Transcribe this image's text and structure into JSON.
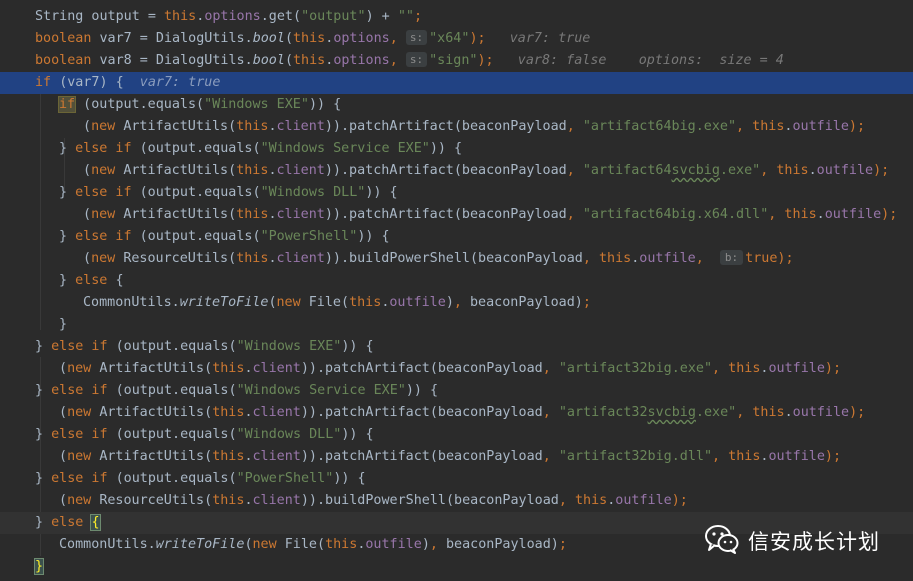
{
  "lines": [
    {
      "id": "l1",
      "parts": [
        {
          "t": "String output = ",
          "c": ""
        },
        {
          "t": "this",
          "c": "kw"
        },
        {
          "t": ".",
          "c": ""
        },
        {
          "t": "options",
          "c": "fld"
        },
        {
          "t": ".get(",
          "c": ""
        },
        {
          "t": "\"output\"",
          "c": "str"
        },
        {
          "t": ") + ",
          "c": ""
        },
        {
          "t": "\"\"",
          "c": "str"
        },
        {
          "t": ";",
          "c": "kw"
        }
      ]
    },
    {
      "id": "l2",
      "parts": [
        {
          "t": "boolean ",
          "c": "kw"
        },
        {
          "t": "var7 = DialogUtils.",
          "c": ""
        },
        {
          "t": "bool",
          "c": "it"
        },
        {
          "t": "(",
          "c": ""
        },
        {
          "t": "this",
          "c": "kw"
        },
        {
          "t": ".",
          "c": ""
        },
        {
          "t": "options",
          "c": "fld"
        },
        {
          "t": ",",
          "c": "kw"
        },
        {
          "t": " ",
          "c": ""
        },
        {
          "t": "s:",
          "c": "hint"
        },
        {
          "t": "\"x64\"",
          "c": "str"
        },
        {
          "t": ");",
          "c": "kw"
        },
        {
          "t": "   var7: true",
          "c": "dbg"
        }
      ]
    },
    {
      "id": "l3",
      "parts": [
        {
          "t": "boolean ",
          "c": "kw"
        },
        {
          "t": "var8 = DialogUtils.",
          "c": ""
        },
        {
          "t": "bool",
          "c": "it"
        },
        {
          "t": "(",
          "c": ""
        },
        {
          "t": "this",
          "c": "kw"
        },
        {
          "t": ".",
          "c": ""
        },
        {
          "t": "options",
          "c": "fld"
        },
        {
          "t": ",",
          "c": "kw"
        },
        {
          "t": " ",
          "c": ""
        },
        {
          "t": "s:",
          "c": "hint"
        },
        {
          "t": "\"sign\"",
          "c": "str"
        },
        {
          "t": ");",
          "c": "kw"
        },
        {
          "t": "   var8: false    options:  size = 4",
          "c": "dbg"
        }
      ]
    },
    {
      "id": "l4",
      "parts": [
        {
          "t": "if ",
          "c": "kw"
        },
        {
          "t": "(var7) {",
          "c": ""
        },
        {
          "t": "  var7: true",
          "c": "dbg-hl"
        }
      ]
    },
    {
      "id": "l5",
      "parts": [
        {
          "t": "if",
          "c": "kw boxkw"
        },
        {
          "t": " (output.equals(",
          "c": ""
        },
        {
          "t": "\"Windows EXE\"",
          "c": "str"
        },
        {
          "t": ")) {",
          "c": ""
        }
      ]
    },
    {
      "id": "l6",
      "parts": [
        {
          "t": "(",
          "c": ""
        },
        {
          "t": "new ",
          "c": "kw"
        },
        {
          "t": "ArtifactUtils(",
          "c": ""
        },
        {
          "t": "this",
          "c": "kw"
        },
        {
          "t": ".",
          "c": ""
        },
        {
          "t": "client",
          "c": "fld"
        },
        {
          "t": ")).patchArtifact(beaconPayload",
          "c": ""
        },
        {
          "t": ", ",
          "c": "kw"
        },
        {
          "t": "\"artifact64big.exe\"",
          "c": "str"
        },
        {
          "t": ", ",
          "c": "kw"
        },
        {
          "t": "this",
          "c": "kw"
        },
        {
          "t": ".",
          "c": ""
        },
        {
          "t": "outfile",
          "c": "fld"
        },
        {
          "t": ");",
          "c": "kw"
        }
      ]
    },
    {
      "id": "l7",
      "parts": [
        {
          "t": "} ",
          "c": ""
        },
        {
          "t": "else if ",
          "c": "kw"
        },
        {
          "t": "(output.equals(",
          "c": ""
        },
        {
          "t": "\"Windows Service EXE\"",
          "c": "str"
        },
        {
          "t": ")) {",
          "c": ""
        }
      ]
    },
    {
      "id": "l8",
      "parts": [
        {
          "t": "(",
          "c": ""
        },
        {
          "t": "new ",
          "c": "kw"
        },
        {
          "t": "ArtifactUtils(",
          "c": ""
        },
        {
          "t": "this",
          "c": "kw"
        },
        {
          "t": ".",
          "c": ""
        },
        {
          "t": "client",
          "c": "fld"
        },
        {
          "t": ")).patchArtifact(beaconPayload",
          "c": ""
        },
        {
          "t": ", ",
          "c": "kw"
        },
        {
          "t": "\"artifact64",
          "c": "str"
        },
        {
          "t": "svcbig",
          "c": "str wavy"
        },
        {
          "t": ".exe\"",
          "c": "str"
        },
        {
          "t": ", ",
          "c": "kw"
        },
        {
          "t": "this",
          "c": "kw"
        },
        {
          "t": ".",
          "c": ""
        },
        {
          "t": "outfile",
          "c": "fld"
        },
        {
          "t": ");",
          "c": "kw"
        }
      ]
    },
    {
      "id": "l9",
      "parts": [
        {
          "t": "} ",
          "c": ""
        },
        {
          "t": "else if ",
          "c": "kw"
        },
        {
          "t": "(output.equals(",
          "c": ""
        },
        {
          "t": "\"Windows DLL\"",
          "c": "str"
        },
        {
          "t": ")) {",
          "c": ""
        }
      ]
    },
    {
      "id": "l10",
      "parts": [
        {
          "t": "(",
          "c": ""
        },
        {
          "t": "new ",
          "c": "kw"
        },
        {
          "t": "ArtifactUtils(",
          "c": ""
        },
        {
          "t": "this",
          "c": "kw"
        },
        {
          "t": ".",
          "c": ""
        },
        {
          "t": "client",
          "c": "fld"
        },
        {
          "t": ")).patchArtifact(beaconPayload",
          "c": ""
        },
        {
          "t": ", ",
          "c": "kw"
        },
        {
          "t": "\"artifact64big.x64.dll\"",
          "c": "str"
        },
        {
          "t": ", ",
          "c": "kw"
        },
        {
          "t": "this",
          "c": "kw"
        },
        {
          "t": ".",
          "c": ""
        },
        {
          "t": "outfile",
          "c": "fld"
        },
        {
          "t": ");",
          "c": "kw"
        }
      ]
    },
    {
      "id": "l11",
      "parts": [
        {
          "t": "} ",
          "c": ""
        },
        {
          "t": "else if ",
          "c": "kw"
        },
        {
          "t": "(output.equals(",
          "c": ""
        },
        {
          "t": "\"PowerShell\"",
          "c": "str"
        },
        {
          "t": ")) {",
          "c": ""
        }
      ]
    },
    {
      "id": "l12",
      "parts": [
        {
          "t": "(",
          "c": ""
        },
        {
          "t": "new ",
          "c": "kw"
        },
        {
          "t": "ResourceUtils(",
          "c": ""
        },
        {
          "t": "this",
          "c": "kw"
        },
        {
          "t": ".",
          "c": ""
        },
        {
          "t": "client",
          "c": "fld"
        },
        {
          "t": ")).buildPowerShell(beaconPayload",
          "c": ""
        },
        {
          "t": ", ",
          "c": "kw"
        },
        {
          "t": "this",
          "c": "kw"
        },
        {
          "t": ".",
          "c": ""
        },
        {
          "t": "outfile",
          "c": "fld"
        },
        {
          "t": ", ",
          "c": "kw"
        },
        {
          "t": " ",
          "c": ""
        },
        {
          "t": "b:",
          "c": "hint b"
        },
        {
          "t": "true",
          "c": "kw"
        },
        {
          "t": ");",
          "c": "kw"
        }
      ]
    },
    {
      "id": "l13",
      "parts": [
        {
          "t": "} ",
          "c": ""
        },
        {
          "t": "else ",
          "c": "kw"
        },
        {
          "t": "{",
          "c": ""
        }
      ]
    },
    {
      "id": "l14",
      "parts": [
        {
          "t": "CommonUtils.",
          "c": ""
        },
        {
          "t": "writeToFile",
          "c": "it"
        },
        {
          "t": "(",
          "c": ""
        },
        {
          "t": "new ",
          "c": "kw"
        },
        {
          "t": "File(",
          "c": ""
        },
        {
          "t": "this",
          "c": "kw"
        },
        {
          "t": ".",
          "c": ""
        },
        {
          "t": "outfile",
          "c": "fld"
        },
        {
          "t": ")",
          "c": ""
        },
        {
          "t": ", ",
          "c": "kw"
        },
        {
          "t": "beaconPayload)",
          "c": ""
        },
        {
          "t": ";",
          "c": "kw"
        }
      ]
    },
    {
      "id": "l15",
      "parts": [
        {
          "t": "}",
          "c": ""
        }
      ]
    },
    {
      "id": "l16",
      "parts": [
        {
          "t": "} ",
          "c": ""
        },
        {
          "t": "else if ",
          "c": "kw"
        },
        {
          "t": "(output.equals(",
          "c": ""
        },
        {
          "t": "\"Windows EXE\"",
          "c": "str"
        },
        {
          "t": ")) {",
          "c": ""
        }
      ]
    },
    {
      "id": "l17",
      "parts": [
        {
          "t": "(",
          "c": ""
        },
        {
          "t": "new ",
          "c": "kw"
        },
        {
          "t": "ArtifactUtils(",
          "c": ""
        },
        {
          "t": "this",
          "c": "kw"
        },
        {
          "t": ".",
          "c": ""
        },
        {
          "t": "client",
          "c": "fld"
        },
        {
          "t": ")).patchArtifact(beaconPayload",
          "c": ""
        },
        {
          "t": ", ",
          "c": "kw"
        },
        {
          "t": "\"artifact32big.exe\"",
          "c": "str"
        },
        {
          "t": ", ",
          "c": "kw"
        },
        {
          "t": "this",
          "c": "kw"
        },
        {
          "t": ".",
          "c": ""
        },
        {
          "t": "outfile",
          "c": "fld"
        },
        {
          "t": ");",
          "c": "kw"
        }
      ]
    },
    {
      "id": "l18",
      "parts": [
        {
          "t": "} ",
          "c": ""
        },
        {
          "t": "else if ",
          "c": "kw"
        },
        {
          "t": "(output.equals(",
          "c": ""
        },
        {
          "t": "\"Windows Service EXE\"",
          "c": "str"
        },
        {
          "t": ")) {",
          "c": ""
        }
      ]
    },
    {
      "id": "l19",
      "parts": [
        {
          "t": "(",
          "c": ""
        },
        {
          "t": "new ",
          "c": "kw"
        },
        {
          "t": "ArtifactUtils(",
          "c": ""
        },
        {
          "t": "this",
          "c": "kw"
        },
        {
          "t": ".",
          "c": ""
        },
        {
          "t": "client",
          "c": "fld"
        },
        {
          "t": ")).patchArtifact(beaconPayload",
          "c": ""
        },
        {
          "t": ", ",
          "c": "kw"
        },
        {
          "t": "\"artifact32",
          "c": "str"
        },
        {
          "t": "svcbig",
          "c": "str wavy"
        },
        {
          "t": ".exe\"",
          "c": "str"
        },
        {
          "t": ", ",
          "c": "kw"
        },
        {
          "t": "this",
          "c": "kw"
        },
        {
          "t": ".",
          "c": ""
        },
        {
          "t": "outfile",
          "c": "fld"
        },
        {
          "t": ");",
          "c": "kw"
        }
      ]
    },
    {
      "id": "l20",
      "parts": [
        {
          "t": "} ",
          "c": ""
        },
        {
          "t": "else if ",
          "c": "kw"
        },
        {
          "t": "(output.equals(",
          "c": ""
        },
        {
          "t": "\"Windows DLL\"",
          "c": "str"
        },
        {
          "t": ")) {",
          "c": ""
        }
      ]
    },
    {
      "id": "l21",
      "parts": [
        {
          "t": "(",
          "c": ""
        },
        {
          "t": "new ",
          "c": "kw"
        },
        {
          "t": "ArtifactUtils(",
          "c": ""
        },
        {
          "t": "this",
          "c": "kw"
        },
        {
          "t": ".",
          "c": ""
        },
        {
          "t": "client",
          "c": "fld"
        },
        {
          "t": ")).patchArtifact(beaconPayload",
          "c": ""
        },
        {
          "t": ", ",
          "c": "kw"
        },
        {
          "t": "\"artifact32big.dll\"",
          "c": "str"
        },
        {
          "t": ", ",
          "c": "kw"
        },
        {
          "t": "this",
          "c": "kw"
        },
        {
          "t": ".",
          "c": ""
        },
        {
          "t": "outfile",
          "c": "fld"
        },
        {
          "t": ");",
          "c": "kw"
        }
      ]
    },
    {
      "id": "l22",
      "parts": [
        {
          "t": "} ",
          "c": ""
        },
        {
          "t": "else if ",
          "c": "kw"
        },
        {
          "t": "(output.equals(",
          "c": ""
        },
        {
          "t": "\"PowerShell\"",
          "c": "str"
        },
        {
          "t": ")) {",
          "c": ""
        }
      ]
    },
    {
      "id": "l23",
      "parts": [
        {
          "t": "(",
          "c": ""
        },
        {
          "t": "new ",
          "c": "kw"
        },
        {
          "t": "ResourceUtils(",
          "c": ""
        },
        {
          "t": "this",
          "c": "kw"
        },
        {
          "t": ".",
          "c": ""
        },
        {
          "t": "client",
          "c": "fld"
        },
        {
          "t": ")).buildPowerShell(beaconPayload",
          "c": ""
        },
        {
          "t": ", ",
          "c": "kw"
        },
        {
          "t": "this",
          "c": "kw"
        },
        {
          "t": ".",
          "c": ""
        },
        {
          "t": "outfile",
          "c": "fld"
        },
        {
          "t": ");",
          "c": "kw"
        }
      ]
    },
    {
      "id": "l24",
      "parts": [
        {
          "t": "} ",
          "c": ""
        },
        {
          "t": "else ",
          "c": "kw"
        },
        {
          "t": "{",
          "c": "brace-match"
        }
      ]
    },
    {
      "id": "l25",
      "parts": [
        {
          "t": "CommonUtils.",
          "c": ""
        },
        {
          "t": "writeToFile",
          "c": "it"
        },
        {
          "t": "(",
          "c": ""
        },
        {
          "t": "new ",
          "c": "kw"
        },
        {
          "t": "File(",
          "c": ""
        },
        {
          "t": "this",
          "c": "kw"
        },
        {
          "t": ".",
          "c": ""
        },
        {
          "t": "outfile",
          "c": "fld"
        },
        {
          "t": ")",
          "c": ""
        },
        {
          "t": ", ",
          "c": "kw"
        },
        {
          "t": "beaconPayload)",
          "c": ""
        },
        {
          "t": ";",
          "c": "kw"
        }
      ]
    },
    {
      "id": "l26",
      "parts": [
        {
          "t": "}",
          "c": "brace-match"
        }
      ]
    }
  ],
  "watermark": {
    "text": "信安成长计划",
    "icon": "wechat-icon"
  }
}
